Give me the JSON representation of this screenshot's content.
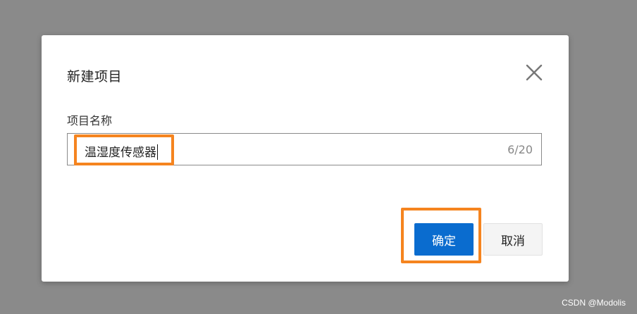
{
  "dialog": {
    "title": "新建项目",
    "field_label": "项目名称",
    "input_value": "温湿度传感器",
    "counter": "6/20",
    "confirm_label": "确定",
    "cancel_label": "取消"
  },
  "watermark": "CSDN @Modolis",
  "colors": {
    "overlay": "#8a8a8a",
    "primary": "#0a6ccf",
    "highlight": "#f5841f"
  }
}
